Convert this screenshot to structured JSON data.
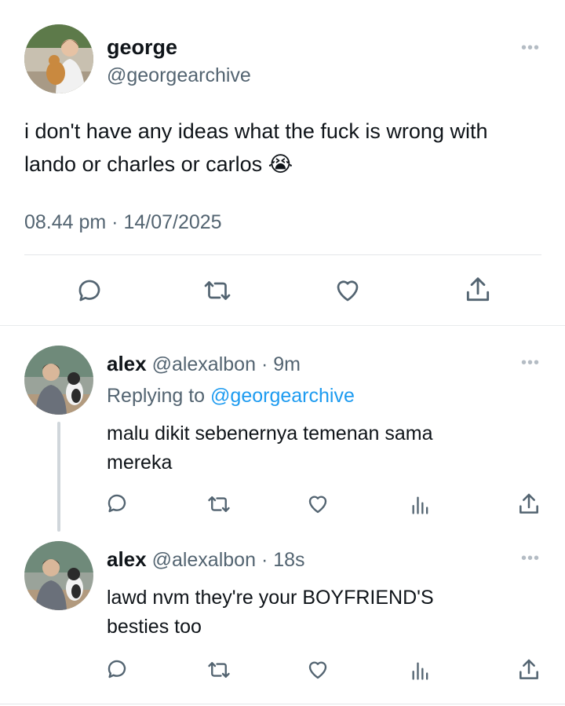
{
  "main_tweet": {
    "name": "george",
    "handle": "@georgearchive",
    "text": "i don't have any ideas what the fuck is wrong with lando or charles or carlos",
    "emoji": "😭",
    "timestamp": "08.44 pm · 14/07/2025",
    "more_label": "•••",
    "actions": [
      "reply-icon",
      "retweet-icon",
      "like-icon",
      "share-icon"
    ]
  },
  "replies": [
    {
      "name": "alex",
      "handle": "@alexalbon",
      "time": "· 9m",
      "replying_prefix": "Replying to",
      "replying_to": "@georgearchive",
      "text_line1": "malu dikit sebenernya temenan sama",
      "text_line2": "mereka",
      "more_label": "•••"
    },
    {
      "name": "alex",
      "handle": "@alexalbon",
      "time": "· 18s",
      "text_line1": "lawd nvm they're your BOYFRIEND'S",
      "text_line2": "besties too",
      "more_label": "•••"
    }
  ],
  "colors": {
    "accent": "#1d9bf0",
    "muted": "#536471",
    "divider": "#e3e6e9"
  }
}
